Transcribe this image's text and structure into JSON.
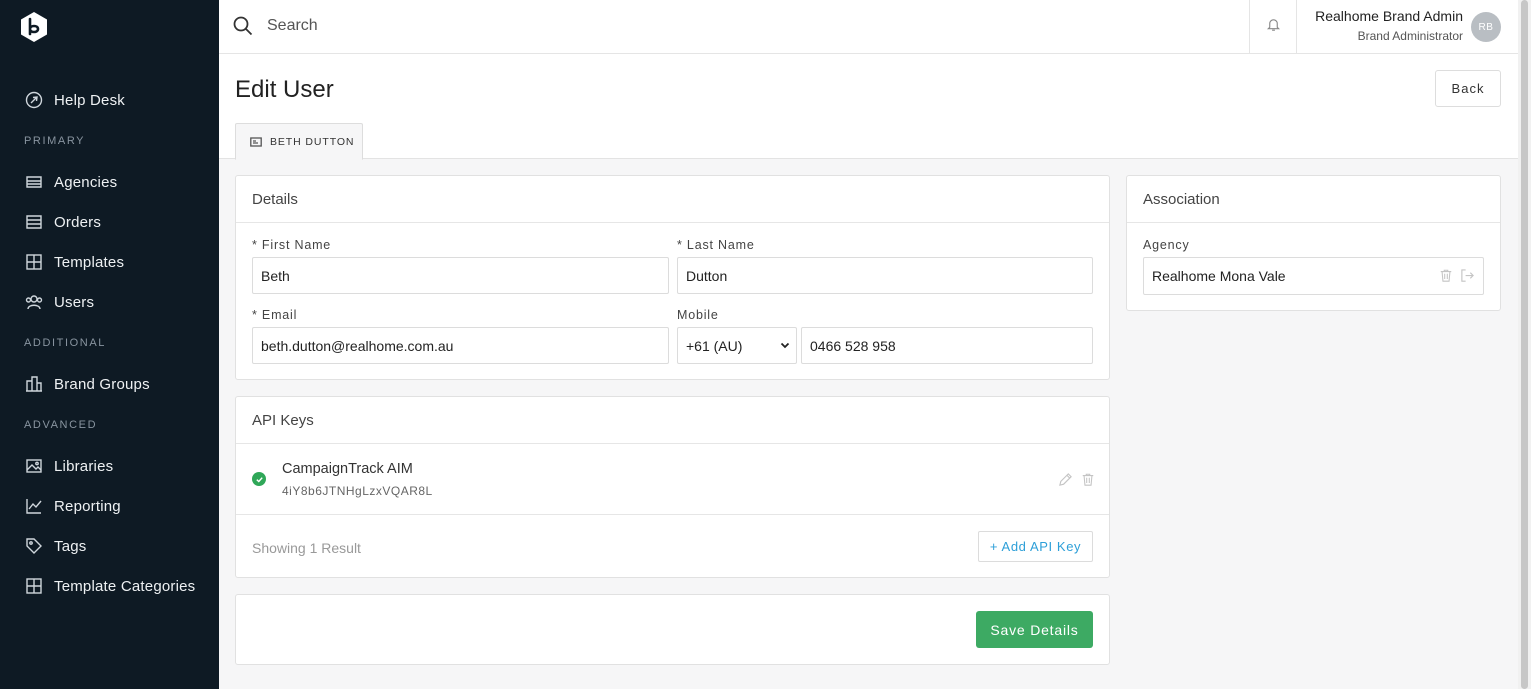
{
  "sidebar": {
    "items": [
      {
        "label": "Help Desk",
        "icon": "help-desk-icon"
      },
      {
        "label": "Agencies",
        "icon": "agencies-icon"
      },
      {
        "label": "Orders",
        "icon": "orders-icon"
      },
      {
        "label": "Templates",
        "icon": "templates-icon"
      },
      {
        "label": "Users",
        "icon": "users-icon"
      },
      {
        "label": "Brand Groups",
        "icon": "brand-groups-icon"
      },
      {
        "label": "Libraries",
        "icon": "libraries-icon"
      },
      {
        "label": "Reporting",
        "icon": "reporting-icon"
      },
      {
        "label": "Tags",
        "icon": "tags-icon"
      },
      {
        "label": "Template Categories",
        "icon": "template-categories-icon"
      }
    ],
    "sections": {
      "primary": "PRIMARY",
      "additional": "ADDITIONAL",
      "advanced": "ADVANCED"
    }
  },
  "topbar": {
    "search_placeholder": "Search",
    "user_name": "Realhome Brand Admin",
    "user_role": "Brand Administrator",
    "avatar_initials": "RB"
  },
  "page": {
    "title": "Edit User",
    "back_label": "Back",
    "tab_label": "BETH DUTTON"
  },
  "details": {
    "heading": "Details",
    "first_name_label": "* First Name",
    "first_name_value": "Beth",
    "last_name_label": "* Last Name",
    "last_name_value": "Dutton",
    "email_label": "* Email",
    "email_value": "beth.dutton@realhome.com.au",
    "mobile_label": "Mobile",
    "country_code": "+61 (AU)",
    "mobile_value": "0466 528 958"
  },
  "api_keys": {
    "heading": "API Keys",
    "items": [
      {
        "name": "CampaignTrack AIM",
        "key": "4iY8b6JTNHgLzxVQAR8L"
      }
    ],
    "showing": "Showing 1 Result",
    "add_label": "+ Add API Key"
  },
  "save": {
    "label": "Save Details"
  },
  "association": {
    "heading": "Association",
    "agency_label": "Agency",
    "agency_value": "Realhome Mona Vale"
  },
  "colors": {
    "sidebar_bg": "#0e1a24",
    "save_green": "#3daa63",
    "check_green": "#2fa758",
    "link_blue": "#2d9fd8"
  }
}
